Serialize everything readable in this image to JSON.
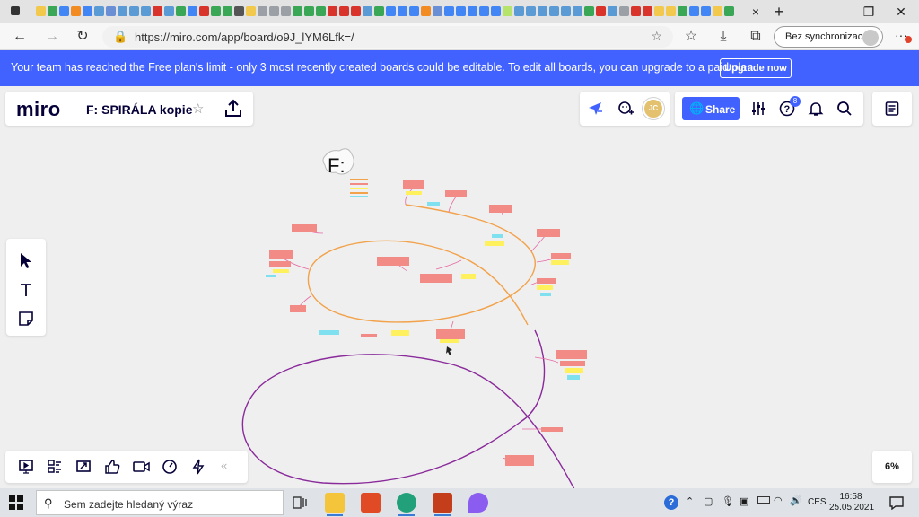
{
  "browser": {
    "url": "https://miro.com/app/board/o9J_lYM6Lfk=/",
    "sync_label": "Bez synchronizace",
    "new_tab": "+",
    "close_tab": "×"
  },
  "banner": {
    "text": "Your team has reached the Free plan's limit - only 3 most recently created boards could be editable. To edit all boards, you can upgrade to a paid plan.",
    "upgrade_label": "Upgrade now"
  },
  "board": {
    "logo": "miro",
    "title": "F: SPIRÁLA kopie",
    "canvas_title": "F:",
    "avatar_initials": "JC",
    "share_label": "Share",
    "help_badge": "8",
    "zoom": "6%"
  },
  "taskbar": {
    "search_placeholder": "Sem zadejte hledaný výraz",
    "language": "CES",
    "time": "16:58",
    "date": "25.05.2021"
  },
  "colors": {
    "accent": "#4262ff",
    "orange_path": "#f2a24a",
    "purple_path": "#8a2a9b",
    "node_red": "#f28a86",
    "node_yellow": "#fff15e",
    "node_cyan": "#7fe1f0",
    "branch": "#e66aa3"
  }
}
